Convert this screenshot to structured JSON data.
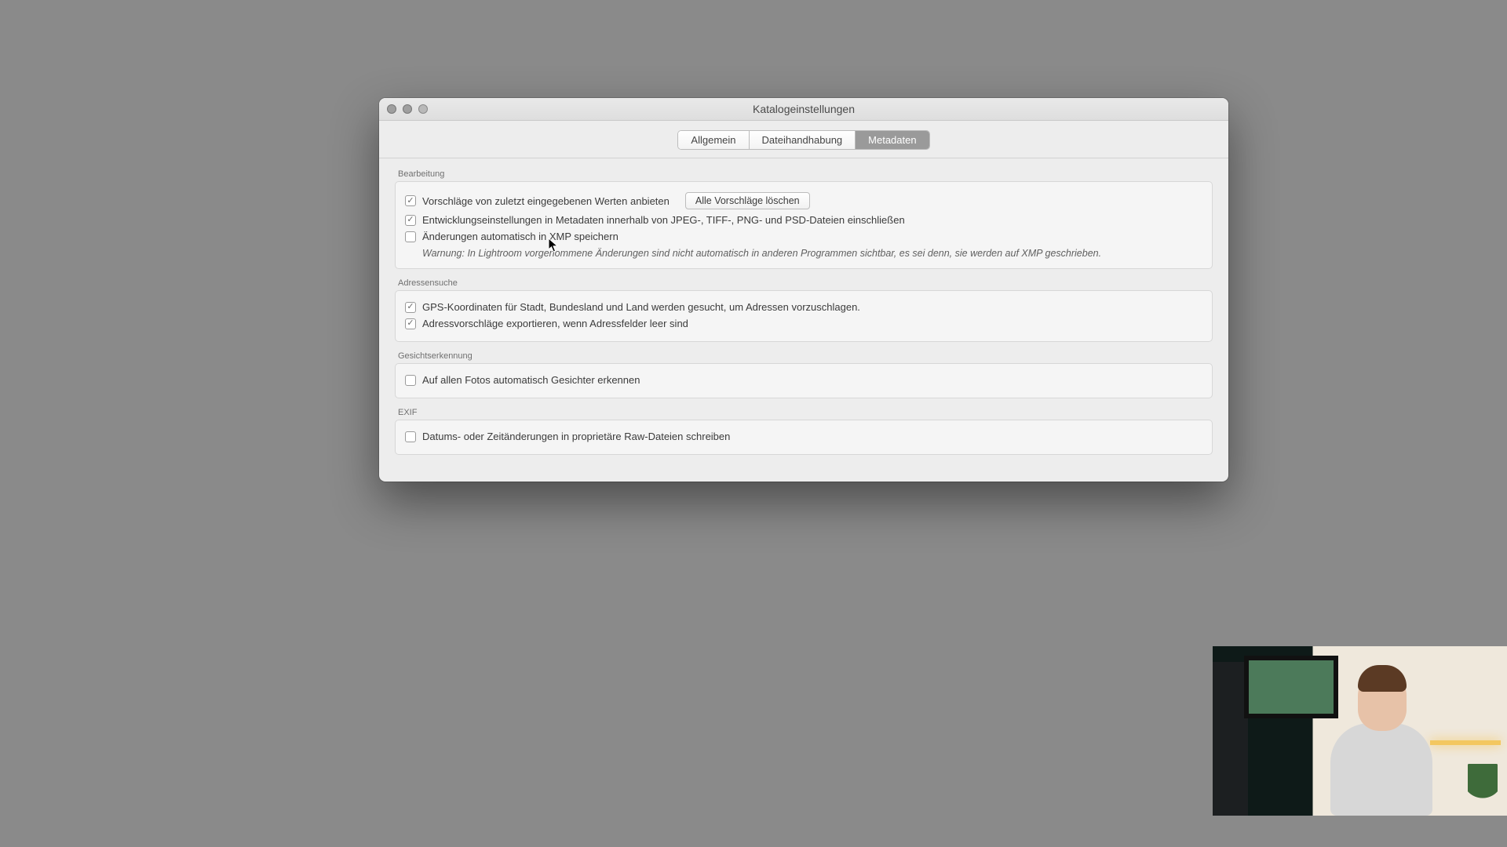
{
  "window": {
    "title": "Katalogeinstellungen"
  },
  "tabs": {
    "general": "Allgemein",
    "filehandling": "Dateihandhabung",
    "metadata": "Metadaten"
  },
  "sections": {
    "editing": {
      "title": "Bearbeitung",
      "suggestions_label": "Vorschläge von zuletzt eingegebenen Werten anbieten",
      "clear_suggestions_btn": "Alle Vorschläge löschen",
      "dev_settings_label": "Entwicklungseinstellungen in Metadaten innerhalb von JPEG-, TIFF-, PNG- und PSD-Dateien einschließen",
      "xmp_auto_label": "Änderungen automatisch in XMP speichern",
      "xmp_warning": "Warnung: In Lightroom vorgenommene Änderungen sind nicht automatisch in anderen Programmen sichtbar, es sei denn, sie werden auf XMP geschrieben."
    },
    "address": {
      "title": "Adressensuche",
      "gps_label": "GPS-Koordinaten für Stadt, Bundesland und Land werden gesucht, um Adressen vorzuschlagen.",
      "export_label": "Adressvorschläge exportieren, wenn Adressfelder leer sind"
    },
    "face": {
      "title": "Gesichtserkennung",
      "auto_label": "Auf allen Fotos automatisch Gesichter erkennen"
    },
    "exif": {
      "title": "EXIF",
      "date_label": "Datums- oder Zeitänderungen in proprietäre Raw-Dateien schreiben"
    }
  }
}
